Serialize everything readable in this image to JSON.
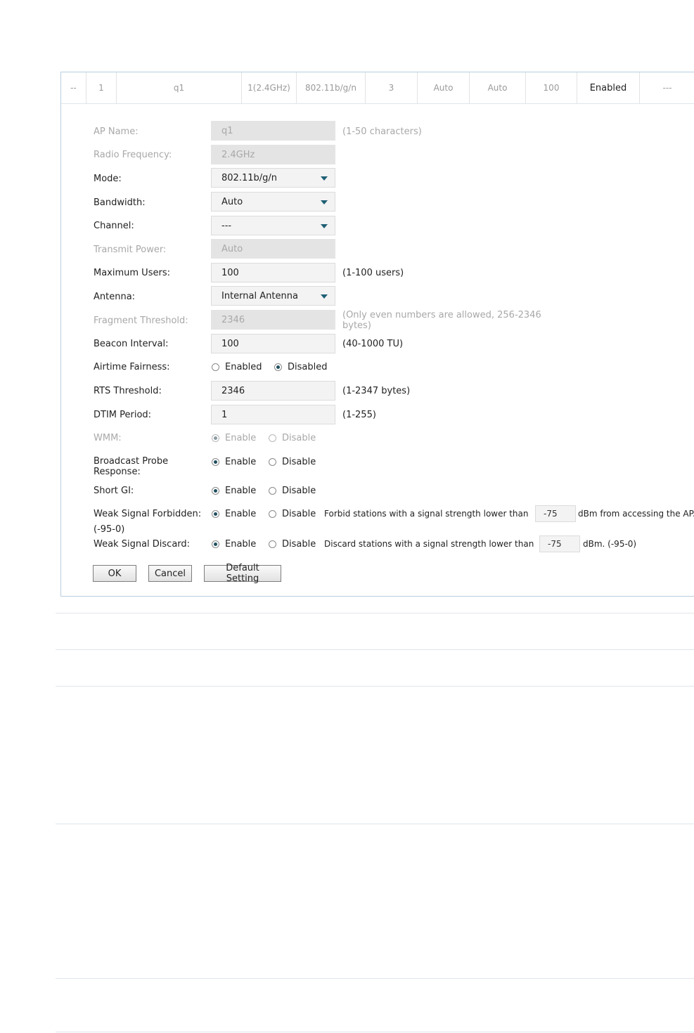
{
  "row": {
    "cells": [
      "--",
      "1",
      "q1",
      "1(2.4GHz)",
      "802.11b/g/n",
      "3",
      "Auto",
      "Auto",
      "100",
      "Enabled",
      "---"
    ]
  },
  "form": {
    "ap_name": {
      "label": "AP Name:",
      "value": "q1",
      "hint": "(1-50 characters)"
    },
    "radio_frequency": {
      "label": "Radio Frequency:",
      "value": "2.4GHz"
    },
    "mode": {
      "label": "Mode:",
      "value": "802.11b/g/n"
    },
    "bandwidth": {
      "label": "Bandwidth:",
      "value": "Auto"
    },
    "channel": {
      "label": "Channel:",
      "value": "---"
    },
    "transmit_power": {
      "label": "Transmit Power:",
      "value": "Auto"
    },
    "maximum_users": {
      "label": "Maximum Users:",
      "value": "100",
      "hint": "(1-100 users)"
    },
    "antenna": {
      "label": "Antenna:",
      "value": "Internal Antenna"
    },
    "fragment_threshold": {
      "label": "Fragment Threshold:",
      "value": "2346",
      "hint_line1": "(Only even numbers are allowed, 256-2346",
      "hint_line2": "bytes)"
    },
    "beacon_interval": {
      "label": "Beacon Interval:",
      "value": "100",
      "hint": "(40-1000 TU)"
    },
    "airtime_fairness": {
      "label": "Airtime Fairness:",
      "opt1": "Enabled",
      "opt2": "Disabled",
      "selected": "Disabled"
    },
    "rts_threshold": {
      "label": "RTS Threshold:",
      "value": "2346",
      "hint": "(1-2347 bytes)"
    },
    "dtim_period": {
      "label": "DTIM Period:",
      "value": "1",
      "hint": "(1-255)"
    },
    "wmm": {
      "label": "WMM:",
      "opt1": "Enable",
      "opt2": "Disable",
      "selected": "Enable"
    },
    "broadcast_probe": {
      "label_line1": "Broadcast Probe",
      "label_line2": "Response:",
      "opt1": "Enable",
      "opt2": "Disable",
      "selected": "Enable"
    },
    "short_gi": {
      "label": "Short GI:",
      "opt1": "Enable",
      "opt2": "Disable",
      "selected": "Enable"
    },
    "weak_signal_forbidden": {
      "label": "Weak Signal Forbidden:",
      "label_line2": "(-95-0)",
      "opt1": "Enable",
      "opt2": "Disable",
      "selected": "Enable",
      "text_before": "Forbid stations with a signal strength lower than",
      "value": "-75",
      "text_after": "dBm from accessing the AP."
    },
    "weak_signal_discard": {
      "label": "Weak Signal Discard:",
      "opt1": "Enable",
      "opt2": "Disable",
      "selected": "Enable",
      "text_before": "Discard stations with a signal strength lower than",
      "value": "-75",
      "text_after": "dBm. (-95-0)"
    }
  },
  "buttons": {
    "ok": "OK",
    "cancel": "Cancel",
    "default": "Default Setting"
  },
  "colors": {
    "border": "#b8cfe0",
    "arrow": "#1e5f74",
    "disabled_text": "#a8a8a8"
  }
}
